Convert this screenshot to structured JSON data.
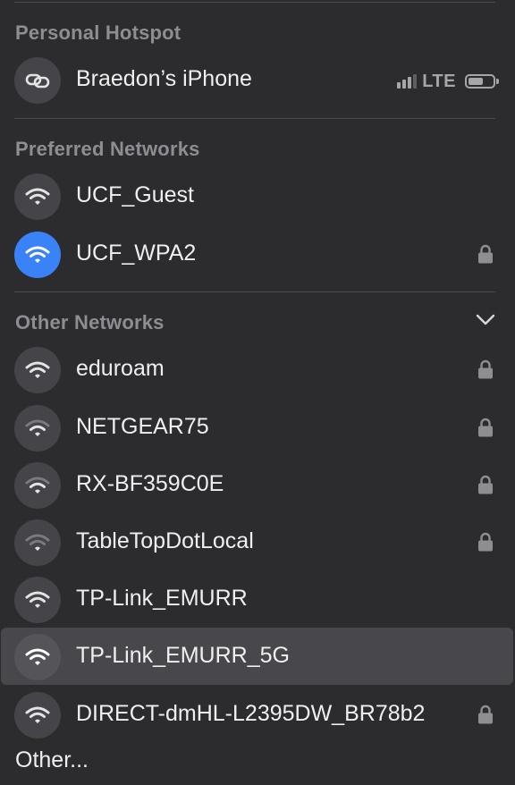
{
  "hotspot": {
    "title": "Personal Hotspot",
    "device": "Braedon’s iPhone",
    "network_type": "LTE",
    "signal_bars": 3,
    "signal_max": 4,
    "battery_level": 0.6
  },
  "preferred": {
    "title": "Preferred Networks",
    "networks": [
      {
        "name": "UCF_Guest",
        "locked": false,
        "connected": false
      },
      {
        "name": "UCF_WPA2",
        "locked": true,
        "connected": true
      }
    ]
  },
  "other": {
    "title": "Other Networks",
    "networks": [
      {
        "name": "eduroam",
        "locked": true
      },
      {
        "name": "NETGEAR75",
        "locked": true
      },
      {
        "name": "RX-BF359C0E",
        "locked": true
      },
      {
        "name": "TableTopDotLocal",
        "locked": true
      },
      {
        "name": "TP-Link_EMURR",
        "locked": false
      },
      {
        "name": "TP-Link_EMURR_5G",
        "locked": false,
        "highlighted": true
      },
      {
        "name": "DIRECT-dmHL-L2395DW_BR78b2",
        "locked": true
      }
    ],
    "other_label": "Other..."
  },
  "colors": {
    "background": "#2c2b2e",
    "active": "#3a82f7",
    "icon_bg": "#454448",
    "highlight": "#48474b"
  },
  "icons": {
    "hotspot": "link-icon",
    "wifi": "wifi-icon",
    "lock": "lock-icon",
    "chevron": "chevron-down-icon"
  }
}
